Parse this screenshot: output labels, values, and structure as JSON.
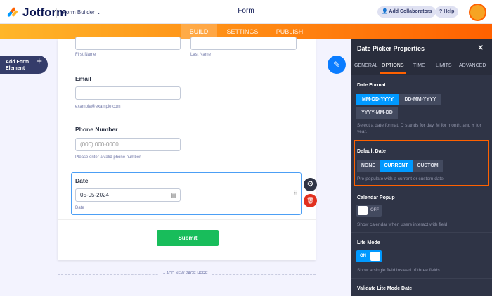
{
  "header": {
    "logo": "Jotform",
    "builder": "Form Builder",
    "title": "Form",
    "add_collaborators": "Add Collaborators",
    "help": "Help"
  },
  "nav": {
    "tabs": [
      "BUILD",
      "SETTINGS",
      "PUBLISH"
    ],
    "active": "BUILD"
  },
  "sidebar": {
    "add_form_element": "Add Form Element"
  },
  "form": {
    "first_name": "First Name",
    "last_name": "Last Name",
    "email_label": "Email",
    "email_sub": "example@example.com",
    "phone_label": "Phone Number",
    "phone_placeholder": "(000) 000-0000",
    "phone_sub": "Please enter a valid phone number.",
    "date_label": "Date",
    "date_value": "05-05-2024",
    "date_sub": "Date",
    "submit": "Submit",
    "add_page": "+ ADD NEW PAGE HERE"
  },
  "panel": {
    "title": "Date Picker Properties",
    "tabs": [
      "GENERAL",
      "OPTIONS",
      "TIME",
      "LIMITS",
      "ADVANCED"
    ],
    "date_format": {
      "label": "Date Format",
      "options": [
        "MM-DD-YYYY",
        "DD-MM-YYYY",
        "YYYY-MM-DD"
      ],
      "selected": "MM-DD-YYYY",
      "desc": "Select a date format. D stands for day, M for month, and Y for year."
    },
    "default_date": {
      "label": "Default Date",
      "options": [
        "NONE",
        "CURRENT",
        "CUSTOM"
      ],
      "selected": "CURRENT",
      "desc": "Pre-populate with a current or custom date"
    },
    "calendar_popup": {
      "label": "Calendar Popup",
      "state": "OFF",
      "desc": "Show calendar when users interact with field"
    },
    "lite_mode": {
      "label": "Lite Mode",
      "state": "ON",
      "desc": "Show a single field instead of three fields"
    },
    "validate": {
      "label": "Validate Lite Mode Date"
    }
  },
  "colors": {
    "accent": "#0099ff",
    "orange": "#ff6100",
    "panel": "#2f3446",
    "submit": "#18bd5b"
  }
}
